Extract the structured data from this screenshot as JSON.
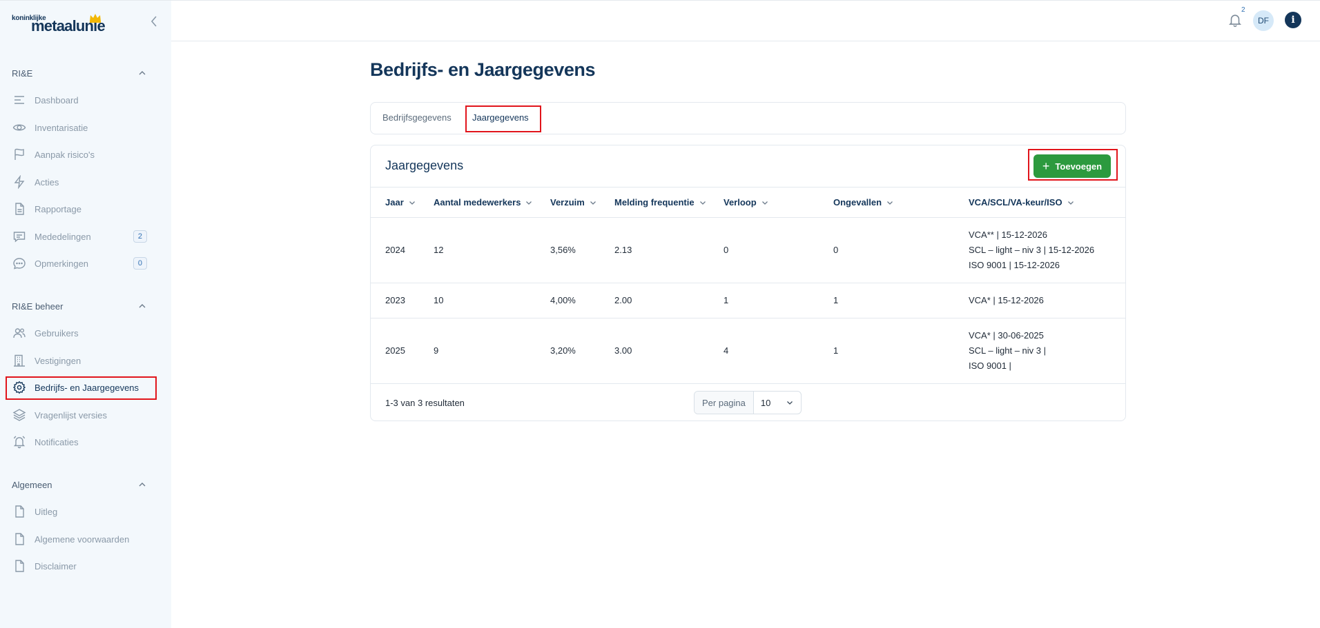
{
  "brand": {
    "small": "koninklijke",
    "big": "metaalunie"
  },
  "sidebar": {
    "sections": [
      {
        "title": "RI&E"
      },
      {
        "title": "RI&E beheer"
      },
      {
        "title": "Algemeen"
      }
    ],
    "items": [
      {
        "label": "Dashboard",
        "icon": "menu-lines-icon"
      },
      {
        "label": "Inventarisatie",
        "icon": "eye-icon"
      },
      {
        "label": "Aanpak risico's",
        "icon": "flag-icon"
      },
      {
        "label": "Acties",
        "icon": "bolt-icon"
      },
      {
        "label": "Rapportage",
        "icon": "document-icon"
      },
      {
        "label": "Mededelingen",
        "icon": "message-icon",
        "badge": "2"
      },
      {
        "label": "Opmerkingen",
        "icon": "chat-dots-icon",
        "badge": "0"
      },
      {
        "label": "Gebruikers",
        "icon": "users-icon"
      },
      {
        "label": "Vestigingen",
        "icon": "building-icon"
      },
      {
        "label": "Bedrijfs- en Jaargegevens",
        "icon": "gear-icon"
      },
      {
        "label": "Vragenlijst versies",
        "icon": "layers-icon"
      },
      {
        "label": "Notificaties",
        "icon": "bell-icon"
      },
      {
        "label": "Uitleg",
        "icon": "file-icon"
      },
      {
        "label": "Algemene voorwaarden",
        "icon": "file-icon"
      },
      {
        "label": "Disclaimer",
        "icon": "file-icon"
      }
    ]
  },
  "topbar": {
    "notification_count": "2",
    "avatar_initials": "DF",
    "info_label": "i"
  },
  "page": {
    "title": "Bedrijfs- en Jaargegevens",
    "tabs": [
      {
        "label": "Bedrijfsgegevens"
      },
      {
        "label": "Jaargegevens"
      }
    ]
  },
  "card": {
    "title": "Jaargegevens",
    "add_label": "Toevoegen",
    "columns": [
      "Jaar",
      "Aantal medewerkers",
      "Verzuim",
      "Melding frequentie",
      "Verloop",
      "Ongevallen",
      "VCA/SCL/VA-keur/ISO"
    ],
    "rows": [
      {
        "jaar": "2024",
        "medewerkers": "12",
        "verzuim": "3,56%",
        "frequentie": "2.13",
        "verloop": "0",
        "ongevallen": "0",
        "certs": [
          "VCA** | 15-12-2026",
          "SCL – light – niv 3 | 15-12-2026",
          "ISO 9001 | 15-12-2026"
        ]
      },
      {
        "jaar": "2023",
        "medewerkers": "10",
        "verzuim": "4,00%",
        "frequentie": "2.00",
        "verloop": "1",
        "ongevallen": "1",
        "certs": [
          "VCA* | 15-12-2026"
        ]
      },
      {
        "jaar": "2025",
        "medewerkers": "9",
        "verzuim": "3,20%",
        "frequentie": "3.00",
        "verloop": "4",
        "ongevallen": "1",
        "certs": [
          "VCA* | 30-06-2025",
          "SCL – light – niv 3 |",
          "ISO 9001 |"
        ]
      }
    ],
    "results_text": "1-3 van 3 resultaten",
    "per_page_label": "Per pagina",
    "per_page_value": "10"
  },
  "colors": {
    "brand_navy": "#14365a",
    "accent_green": "#2c9a3e",
    "highlight_red": "#e1141b",
    "sidebar_bg": "#f3f8fc"
  }
}
